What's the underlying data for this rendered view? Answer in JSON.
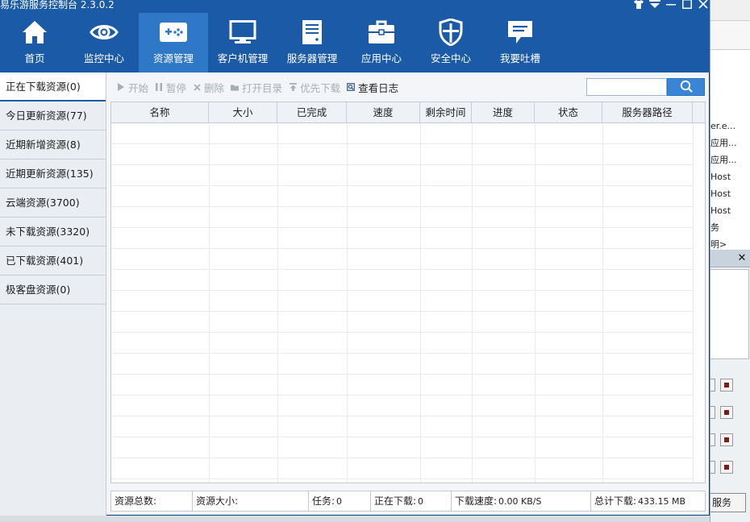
{
  "app": {
    "title": "易乐游服务控制台 2.3.0.2"
  },
  "nav": {
    "items": [
      {
        "label": "首页",
        "icon": "home-icon"
      },
      {
        "label": "监控中心",
        "icon": "eye-icon"
      },
      {
        "label": "资源管理",
        "icon": "gamepad-icon",
        "active": true
      },
      {
        "label": "客户机管理",
        "icon": "monitor-icon"
      },
      {
        "label": "服务器管理",
        "icon": "server-icon"
      },
      {
        "label": "应用中心",
        "icon": "toolbox-icon"
      },
      {
        "label": "安全中心",
        "icon": "shield-icon"
      },
      {
        "label": "我要吐槽",
        "icon": "chat-icon"
      }
    ]
  },
  "sidebar": {
    "items": [
      {
        "label": "正在下载资源(0)",
        "active": true
      },
      {
        "label": "今日更新资源(77)"
      },
      {
        "label": "近期新增资源(8)"
      },
      {
        "label": "近期更新资源(135)"
      },
      {
        "label": "云端资源(3700)"
      },
      {
        "label": "未下载资源(3320)"
      },
      {
        "label": "已下载资源(401)"
      },
      {
        "label": "极客盘资源(0)"
      }
    ]
  },
  "toolbar": {
    "start": "开始",
    "pause": "暂停",
    "delete": "删除",
    "open_dir": "打开目录",
    "priority": "优先下载",
    "view_log": "查看日志",
    "search_value": ""
  },
  "table": {
    "columns": [
      "名称",
      "大小",
      "已完成",
      "速度",
      "剩余时间",
      "进度",
      "状态",
      "服务器路径"
    ],
    "rows": []
  },
  "status": {
    "total_label": "资源总数:",
    "total_value": "",
    "size_label": "资源大小:",
    "size_value": "",
    "tasks_label": "任务:",
    "tasks_value": "0",
    "downloading_label": "正在下载:",
    "downloading_value": "0",
    "speed_label": "下载速度:",
    "speed_value": "0.00 KB/S",
    "total_dl_label": "总计下载:",
    "total_dl_value": "433.15 MB"
  },
  "background_window": {
    "list_items": [
      "er.e...",
      "应用...",
      "应用...",
      "Host",
      "Host",
      "Host",
      "务",
      "明>"
    ],
    "service_button": "服务"
  },
  "colors": {
    "header": "#1a5aa6",
    "nav_active": "#2f78c8",
    "search_button": "#3a86d6"
  }
}
